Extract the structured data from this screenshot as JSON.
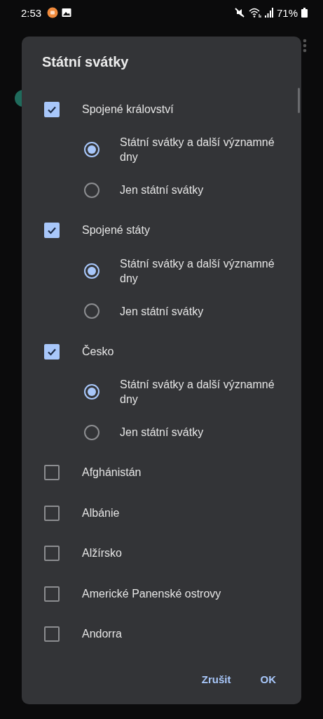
{
  "status_bar": {
    "time": "2:53",
    "battery": "71%"
  },
  "dialog": {
    "title": "Státní svátky",
    "items": [
      {
        "label": "Spojené království",
        "checked": true,
        "options": [
          {
            "label": "Státní svátky a další významné dny",
            "selected": true
          },
          {
            "label": "Jen státní svátky",
            "selected": false
          }
        ]
      },
      {
        "label": "Spojené státy",
        "checked": true,
        "options": [
          {
            "label": "Státní svátky a další významné dny",
            "selected": true
          },
          {
            "label": "Jen státní svátky",
            "selected": false
          }
        ]
      },
      {
        "label": "Česko",
        "checked": true,
        "options": [
          {
            "label": "Státní svátky a další významné dny",
            "selected": true
          },
          {
            "label": "Jen státní svátky",
            "selected": false
          }
        ]
      },
      {
        "label": "Afghánistán",
        "checked": false
      },
      {
        "label": "Albánie",
        "checked": false
      },
      {
        "label": "Alžírsko",
        "checked": false
      },
      {
        "label": "Americké Panenské ostrovy",
        "checked": false
      },
      {
        "label": "Andorra",
        "checked": false
      }
    ],
    "buttons": [
      "Zrušit",
      "OK"
    ]
  }
}
